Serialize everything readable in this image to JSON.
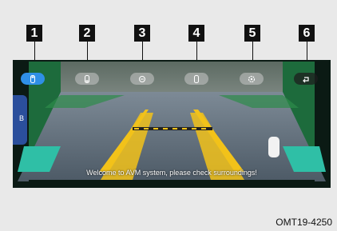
{
  "callouts": [
    "1",
    "2",
    "3",
    "4",
    "5",
    "6"
  ],
  "toolbar": {
    "buttons": [
      {
        "icon": "front-camera-icon",
        "state": "active"
      },
      {
        "icon": "rear-camera-icon",
        "state": "normal"
      },
      {
        "icon": "view-switch-icon",
        "state": "normal"
      },
      {
        "icon": "side-camera-icon",
        "state": "normal"
      },
      {
        "icon": "settings-icon",
        "state": "normal"
      },
      {
        "icon": "back-icon",
        "state": "normal"
      }
    ]
  },
  "screen": {
    "view_label": "B",
    "welcome_message": "Welcome to AVM system, please check surroundings!"
  },
  "caption": "OMT19-4250",
  "colors": {
    "active_button": "#2f8fe6",
    "guide_lines": "#f2c21a",
    "side_markers": "#2fbfa6"
  }
}
